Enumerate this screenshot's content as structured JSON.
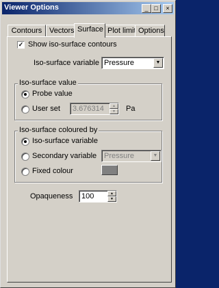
{
  "window": {
    "title": "Viewer Options",
    "controls": {
      "minimize": "_",
      "maximize": "□",
      "close": "×"
    }
  },
  "tabs": [
    {
      "label": "Contours",
      "active": false
    },
    {
      "label": "Vectors",
      "active": false
    },
    {
      "label": "Surface",
      "active": true
    },
    {
      "label": "Plot limits",
      "active": false
    },
    {
      "label": "Options",
      "active": false
    }
  ],
  "surface": {
    "show_contours": {
      "label": "Show iso-surface contours",
      "checked": true,
      "mark": "✓"
    },
    "variable": {
      "label": "Iso-surface variable",
      "value": "Pressure",
      "arrow": "▼"
    },
    "value_group": {
      "title": "Iso-surface value",
      "probe": {
        "label": "Probe value",
        "selected": true
      },
      "user_set": {
        "label": "User set",
        "selected": false,
        "value": "3.676314",
        "unit": "Pa"
      }
    },
    "colour_group": {
      "title": "Iso-surface coloured by",
      "iso_variable": {
        "label": "Iso-surface variable",
        "selected": true
      },
      "secondary": {
        "label": "Secondary variable",
        "selected": false,
        "value": "Pressure"
      },
      "fixed": {
        "label": "Fixed colour",
        "selected": false,
        "swatch_color": "#808080"
      }
    },
    "opaqueness": {
      "label": "Opaqueness",
      "value": "100"
    }
  },
  "icons": {
    "spin_up": "▲",
    "spin_down": "▼"
  }
}
